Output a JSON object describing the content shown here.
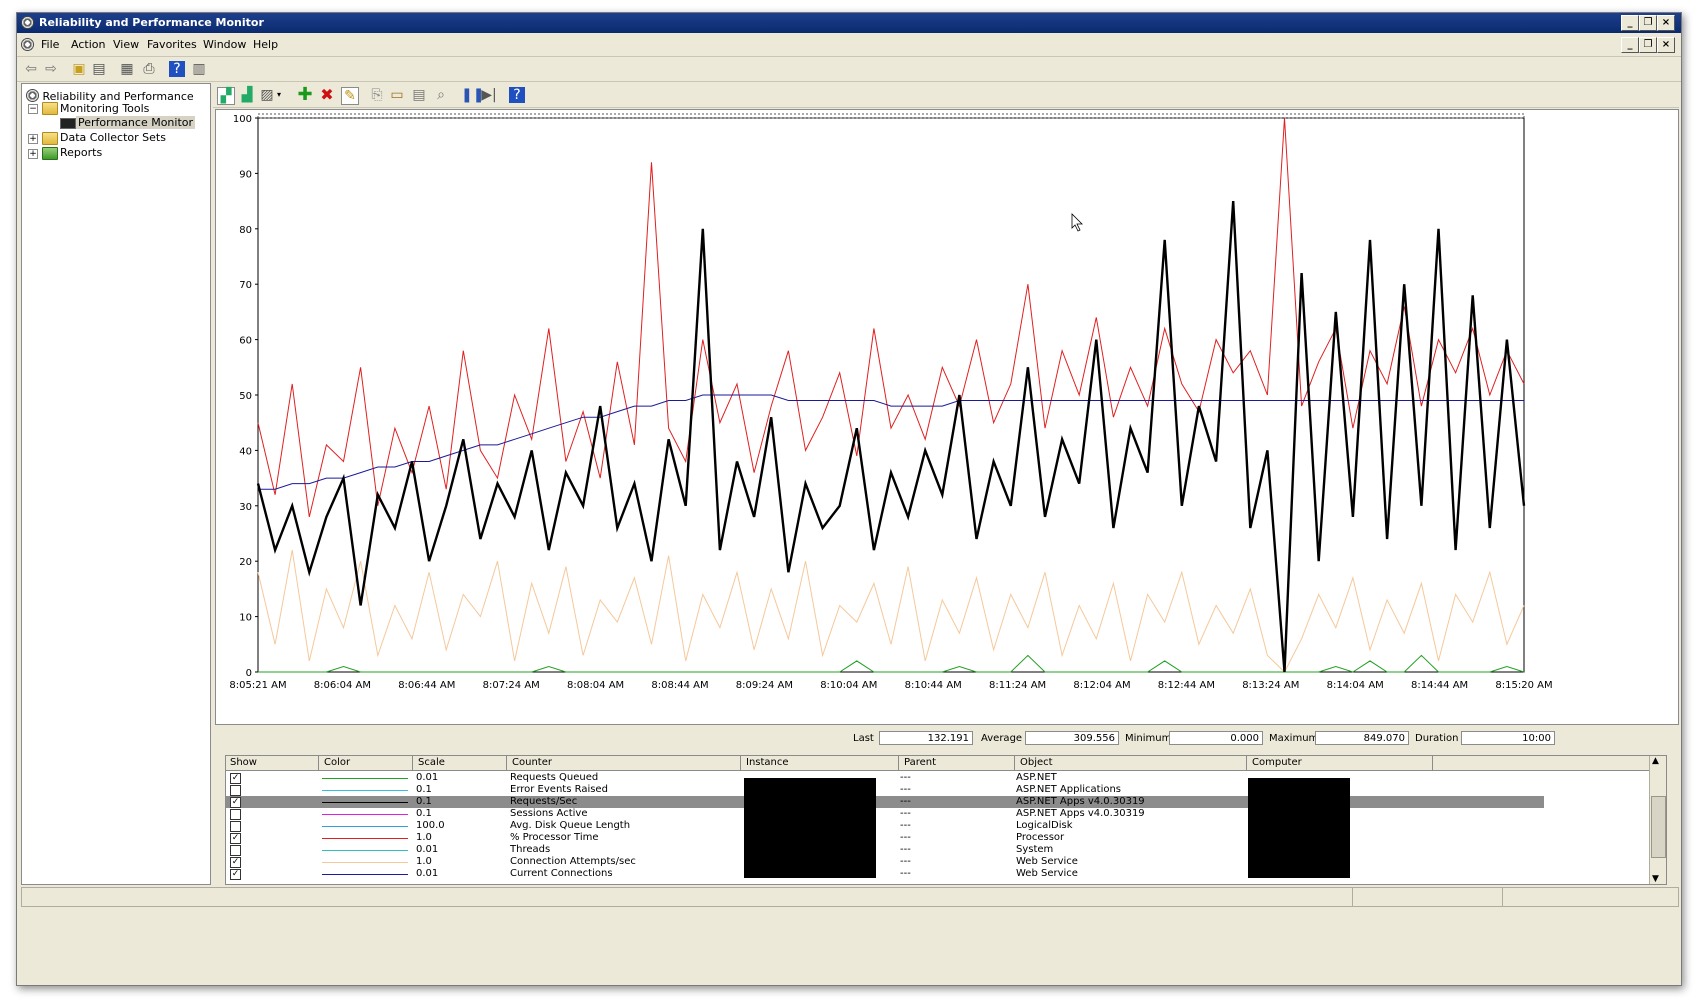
{
  "window": {
    "title": "Reliability and Performance Monitor"
  },
  "menu": [
    "File",
    "Action",
    "View",
    "Favorites",
    "Window",
    "Help"
  ],
  "tree": {
    "root": "Reliability and Performance",
    "monitoring_tools": "Monitoring Tools",
    "performance_monitor": "Performance Monitor",
    "data_collector_sets": "Data Collector Sets",
    "reports": "Reports"
  },
  "stats": {
    "last_label": "Last",
    "last_value": "132.191",
    "average_label": "Average",
    "average_value": "309.556",
    "minimum_label": "Minimum",
    "minimum_value": "0.000",
    "maximum_label": "Maximum",
    "maximum_value": "849.070",
    "duration_label": "Duration",
    "duration_value": "10:00"
  },
  "counters": {
    "headers": {
      "show": "Show",
      "color": "Color",
      "scale": "Scale",
      "counter": "Counter",
      "instance": "Instance",
      "parent": "Parent",
      "object": "Object",
      "computer": "Computer"
    },
    "rows": [
      {
        "show": "✓",
        "color": "#20a020",
        "scale": "0.01",
        "counter": "Requests Queued",
        "parent": "---",
        "object": "ASP.NET"
      },
      {
        "show": "",
        "color": "#30c0e0",
        "scale": "0.1",
        "counter": "Error Events Raised",
        "parent": "---",
        "object": "ASP.NET Applications"
      },
      {
        "show": "✓",
        "color": "#000000",
        "scale": "0.1",
        "counter": "Requests/Sec",
        "parent": "---",
        "object": "ASP.NET Apps v4.0.30319"
      },
      {
        "show": "",
        "color": "#e020e0",
        "scale": "0.1",
        "counter": "Sessions Active",
        "parent": "---",
        "object": "ASP.NET Apps v4.0.30319"
      },
      {
        "show": "",
        "color": "#30a0e0",
        "scale": "100.0",
        "counter": "Avg. Disk Queue Length",
        "parent": "---",
        "object": "LogicalDisk"
      },
      {
        "show": "✓",
        "color": "#e02020",
        "scale": "1.0",
        "counter": "% Processor Time",
        "parent": "---",
        "object": "Processor"
      },
      {
        "show": "",
        "color": "#30c0c0",
        "scale": "0.01",
        "counter": "Threads",
        "parent": "---",
        "object": "System"
      },
      {
        "show": "✓",
        "color": "#f5c89a",
        "scale": "1.0",
        "counter": "Connection Attempts/sec",
        "parent": "---",
        "object": "Web Service"
      },
      {
        "show": "✓",
        "color": "#1a1a9a",
        "scale": "0.01",
        "counter": "Current Connections",
        "parent": "---",
        "object": "Web Service"
      }
    ]
  },
  "chart_data": {
    "type": "line",
    "ylim": [
      0,
      100
    ],
    "y_ticks": [
      "100",
      "90",
      "80",
      "70",
      "60",
      "50",
      "40",
      "30",
      "20",
      "10",
      "0"
    ],
    "x_ticks": [
      "8:05:21 AM",
      "8:06:04 AM",
      "8:06:44 AM",
      "8:07:24 AM",
      "8:08:04 AM",
      "8:08:44 AM",
      "8:09:24 AM",
      "8:10:04 AM",
      "8:10:44 AM",
      "8:11:24 AM",
      "8:12:04 AM",
      "8:12:44 AM",
      "8:13:24 AM",
      "8:14:04 AM",
      "8:14:44 AM",
      "8:15:20 AM"
    ],
    "series": [
      {
        "color": "#e02020",
        "values": [
          45,
          32,
          52,
          28,
          41,
          38,
          55,
          30,
          44,
          36,
          48,
          33,
          58,
          40,
          35,
          50,
          42,
          62,
          38,
          47,
          35,
          56,
          41,
          92,
          44,
          38,
          60,
          45,
          52,
          36,
          48,
          58,
          40,
          46,
          54,
          39,
          62,
          44,
          50,
          42,
          55,
          48,
          60,
          45,
          52,
          70,
          44,
          58,
          50,
          64,
          46,
          55,
          48,
          62,
          52,
          47,
          60,
          54,
          58,
          50,
          100,
          48,
          56,
          62,
          44,
          58,
          52,
          66,
          48,
          60,
          54,
          62,
          50,
          58,
          52
        ]
      },
      {
        "color": "#000000",
        "values": [
          34,
          22,
          30,
          18,
          28,
          35,
          12,
          32,
          26,
          38,
          20,
          30,
          42,
          24,
          34,
          28,
          40,
          22,
          36,
          30,
          48,
          26,
          34,
          20,
          42,
          30,
          80,
          22,
          38,
          28,
          46,
          18,
          34,
          26,
          30,
          44,
          22,
          36,
          28,
          40,
          32,
          50,
          24,
          38,
          30,
          55,
          28,
          42,
          34,
          60,
          26,
          44,
          36,
          78,
          30,
          48,
          38,
          85,
          26,
          40,
          0,
          72,
          20,
          65,
          28,
          78,
          24,
          70,
          30,
          80,
          22,
          68,
          26,
          60,
          30
        ]
      },
      {
        "color": "#1a1a9a",
        "values": [
          33,
          33,
          34,
          34,
          35,
          35,
          36,
          37,
          37,
          38,
          38,
          39,
          40,
          41,
          41,
          42,
          43,
          44,
          45,
          46,
          46,
          47,
          48,
          48,
          49,
          49,
          50,
          50,
          50,
          50,
          50,
          49,
          49,
          49,
          49,
          49,
          49,
          48,
          48,
          48,
          48,
          49,
          49,
          49,
          49,
          49,
          49,
          49,
          49,
          49,
          49,
          49,
          49,
          49,
          49,
          49,
          49,
          49,
          49,
          49,
          49,
          49,
          49,
          49,
          49,
          49,
          49,
          49,
          49,
          49,
          49,
          49,
          49,
          49,
          49
        ]
      },
      {
        "color": "#f5c89a",
        "values": [
          18,
          5,
          22,
          2,
          15,
          8,
          20,
          3,
          12,
          6,
          18,
          4,
          14,
          10,
          20,
          2,
          16,
          7,
          19,
          3,
          13,
          9,
          17,
          5,
          21,
          2,
          14,
          8,
          18,
          4,
          15,
          6,
          20,
          3,
          12,
          9,
          16,
          5,
          19,
          2,
          13,
          7,
          17,
          4,
          14,
          8,
          18,
          3,
          12,
          6,
          16,
          2,
          14,
          9,
          18,
          5,
          12,
          7,
          15,
          3,
          0,
          6,
          14,
          8,
          17,
          4,
          13,
          7,
          16,
          2,
          14,
          9,
          18,
          5,
          12
        ]
      },
      {
        "color": "#20a020",
        "values": [
          0,
          0,
          0,
          0,
          0,
          1,
          0,
          0,
          0,
          0,
          0,
          0,
          0,
          0,
          0,
          0,
          0,
          1,
          0,
          0,
          0,
          0,
          0,
          0,
          0,
          0,
          0,
          0,
          0,
          0,
          0,
          0,
          0,
          0,
          0,
          2,
          0,
          0,
          0,
          0,
          0,
          1,
          0,
          0,
          0,
          3,
          0,
          0,
          0,
          0,
          0,
          0,
          0,
          2,
          0,
          0,
          0,
          0,
          0,
          0,
          0,
          0,
          0,
          1,
          0,
          2,
          0,
          0,
          3,
          0,
          0,
          0,
          0,
          1,
          0
        ]
      }
    ]
  }
}
